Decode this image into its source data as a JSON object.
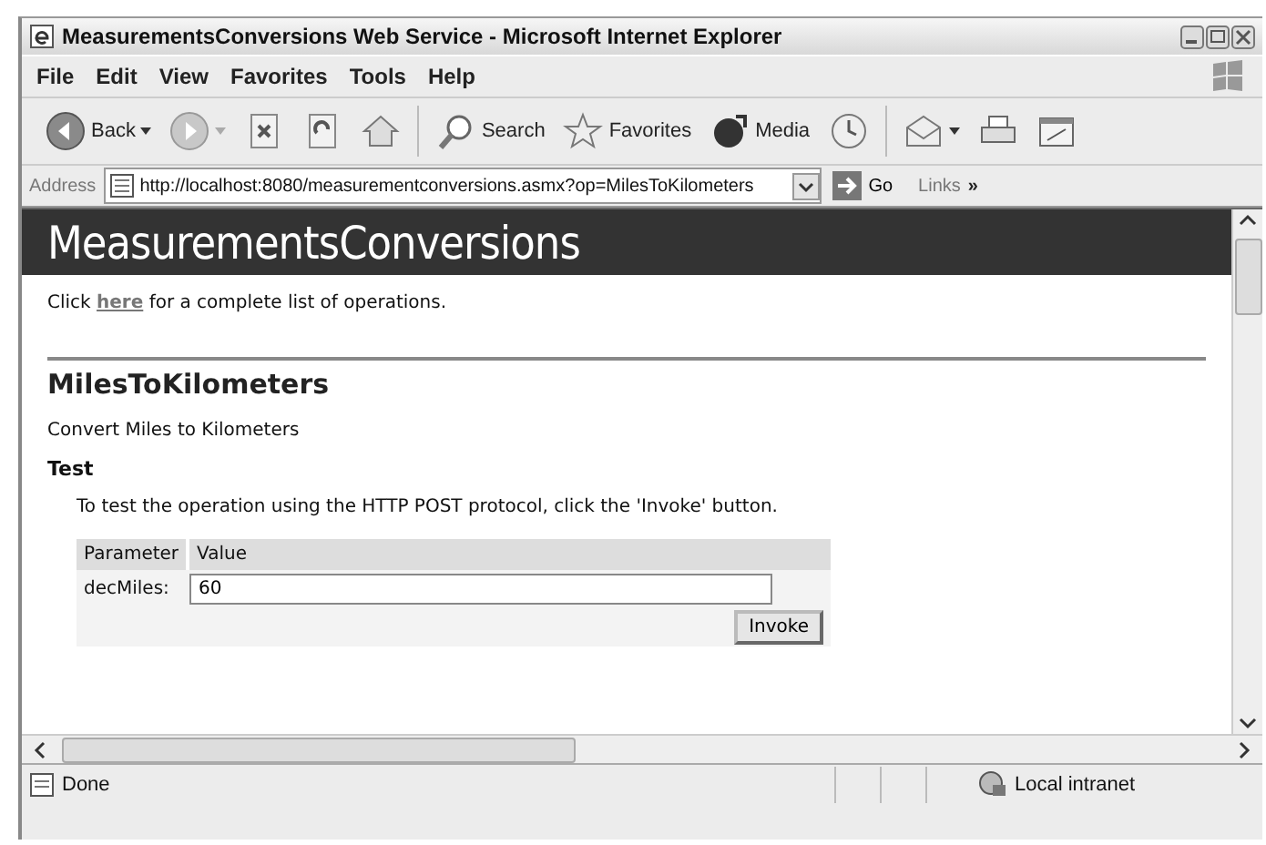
{
  "window": {
    "title": "MeasurementsConversions Web Service - Microsoft Internet Explorer"
  },
  "menu": [
    "File",
    "Edit",
    "View",
    "Favorites",
    "Tools",
    "Help"
  ],
  "toolbar": [
    {
      "kind": "back",
      "label": "Back"
    },
    {
      "kind": "forward"
    },
    {
      "kind": "stop"
    },
    {
      "kind": "refresh"
    },
    {
      "kind": "home"
    },
    {
      "kind": "search",
      "label": "Search"
    },
    {
      "kind": "favorites",
      "label": "Favorites"
    },
    {
      "kind": "media",
      "label": "Media"
    },
    {
      "kind": "history"
    },
    {
      "kind": "mail"
    },
    {
      "kind": "print"
    },
    {
      "kind": "edit"
    }
  ],
  "address_bar": {
    "label": "Address",
    "url": "http://localhost:8080/measurementconversions.asmx?op=MilesToKilometers",
    "go": "Go",
    "links": "Links",
    "chevron": "»"
  },
  "page": {
    "banner": "MeasurementsConversions",
    "intro": {
      "before": "Click",
      "link": "here",
      "after": "for a complete list of operations."
    },
    "operation": "MilesToKilometers",
    "description": "Convert Miles to Kilometers",
    "test_heading": "Test",
    "instructions": "To test the operation using the HTTP POST protocol, click the 'Invoke' button.",
    "table": {
      "columns": [
        "Parameter",
        "Value"
      ],
      "rows": [
        {
          "name": "decMiles:",
          "value": "60"
        }
      ]
    },
    "button": "Invoke"
  },
  "status_bar": {
    "text": "Done",
    "zone": "Local intranet"
  }
}
